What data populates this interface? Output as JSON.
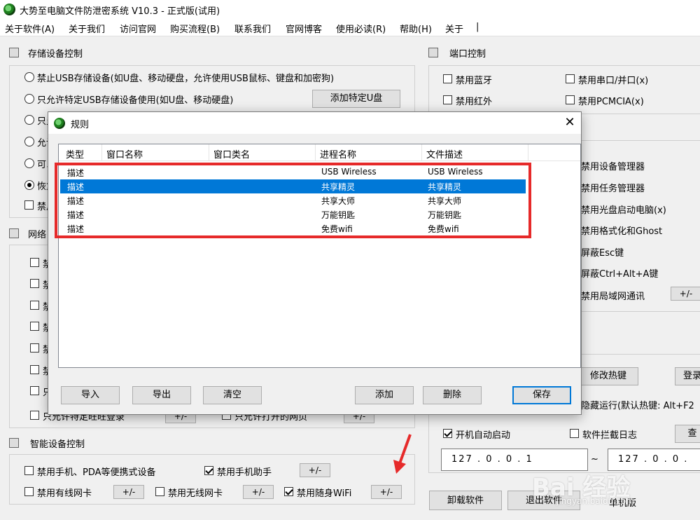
{
  "app": {
    "title": "大势至电脑文件防泄密系统 V10.3 - 正式版(试用)"
  },
  "menu": [
    "关于软件(A)",
    "关于我们",
    "访问官网",
    "购买流程(B)",
    "联系我们",
    "官网博客",
    "使用必读(R)",
    "帮助(H)",
    "关于",
    "|"
  ],
  "storage": {
    "title": "存储设备控制",
    "options": [
      "禁止USB存储设备(如U盘、移动硬盘，允许使用USB鼠标、键盘和加密狗)",
      "只允许特定USB存储设备使用(如U盘、移动硬盘)",
      "只允",
      "允许",
      "可以",
      "恢复"
    ],
    "add_usb_button": "添加特定U盘",
    "disable_cb": "禁用"
  },
  "network": {
    "title": "网络",
    "rows": [
      "禁",
      "禁",
      "禁",
      "禁",
      "禁",
      "禁",
      "只",
      "只允许特定旺旺登录"
    ],
    "plusminus": "+/-",
    "allow_sites": "只允许打开的网页"
  },
  "smart": {
    "title": "智能设备控制",
    "items": [
      {
        "label": "禁用手机、PDA等便携式设备",
        "checked": false
      },
      {
        "label": "禁用手机助手",
        "checked": true
      },
      {
        "label": "禁用有线网卡",
        "checked": false
      },
      {
        "label": "禁用无线网卡",
        "checked": false
      },
      {
        "label": "禁用随身WiFi",
        "checked": true
      }
    ],
    "plusminus": "+/-"
  },
  "port": {
    "title": "端口控制",
    "items": [
      "禁用蓝牙",
      "禁用串口/并口(x)",
      "禁用红外",
      "禁用PCMCIA(x)"
    ]
  },
  "system": {
    "items": [
      "禁用设备管理器",
      "禁用任务管理器",
      "禁用光盘启动电脑(x)",
      "禁用格式化和Ghost",
      "屏蔽Esc键",
      "屏蔽Ctrl+Alt+A键",
      "禁用局域网通讯"
    ],
    "plusminus": "+/-"
  },
  "hotkey": {
    "modify": "修改热键",
    "login": "登录",
    "hidden_run": "隐藏运行(默认热键: Alt+F2",
    "auto_start": "开机自动启动",
    "auto_start_checked": true,
    "block_log": "软件拦截日志",
    "view": "查",
    "ip1": "127 . 0 . 0 . 1",
    "ip_sep": "~",
    "ip2": "127 . 0 . 0 ."
  },
  "bottom": {
    "uninstall": "卸载软件",
    "exit": "退出软件",
    "edition": "单机版"
  },
  "dialog": {
    "title": "规则",
    "close": "✕",
    "columns": [
      "类型",
      "窗口名称",
      "窗口类名",
      "进程名称",
      "文件描述"
    ],
    "rows": [
      {
        "type": "描述",
        "window_name": "",
        "window_class": "",
        "process": "USB Wireless",
        "file_desc": "USB Wireless"
      },
      {
        "type": "描述",
        "window_name": "",
        "window_class": "",
        "process": "共享精灵",
        "file_desc": "共享精灵"
      },
      {
        "type": "描述",
        "window_name": "",
        "window_class": "",
        "process": "共享大师",
        "file_desc": "共享大师"
      },
      {
        "type": "描述",
        "window_name": "",
        "window_class": "",
        "process": "万能钥匙",
        "file_desc": "万能钥匙"
      },
      {
        "type": "描述",
        "window_name": "",
        "window_class": "",
        "process": "免费wifi",
        "file_desc": "免费wifi"
      }
    ],
    "selected_row": 1,
    "buttons": {
      "import": "导入",
      "export": "导出",
      "clear": "清空",
      "add": "添加",
      "delete": "删除",
      "save": "保存"
    }
  },
  "watermark": {
    "brand": "Bai 经验",
    "url": "jingyan.baidu.com"
  },
  "colors": {
    "highlight": "#e62a2a",
    "selection": "#0078d7"
  }
}
